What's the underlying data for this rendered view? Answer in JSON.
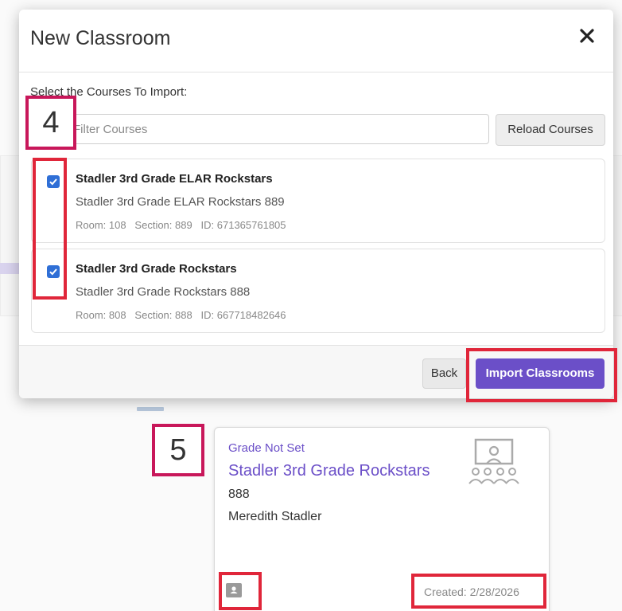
{
  "modal": {
    "title": "New Classroom",
    "close_icon": "close-icon",
    "select_label": "Select the Courses To Import:",
    "filter_placeholder": "Filter Courses",
    "reload_label": "Reload Courses",
    "courses": [
      {
        "checked": true,
        "name": "Stadler 3rd Grade ELAR Rockstars",
        "subtitle": "Stadler 3rd Grade ELAR Rockstars 889",
        "meta": "Room: 108   Section: 889   ID: 671365761805"
      },
      {
        "checked": true,
        "name": "Stadler 3rd Grade Rockstars",
        "subtitle": "Stadler 3rd Grade Rockstars 888",
        "meta": "Room: 808   Section: 888   ID: 667718482646"
      }
    ],
    "back_label": "Back",
    "import_label": "Import Classrooms"
  },
  "annotations": {
    "step_four": "4",
    "step_five": "5",
    "highlight_color": "#e0263a",
    "badge_border_color": "#c8175a"
  },
  "classroom_card": {
    "grade": "Grade Not Set",
    "title": "Stadler 3rd Grade Rockstars",
    "section": "888",
    "teacher": "Meredith Stadler",
    "created": "Created: 2/28/2026",
    "classroom_icon": "classroom-presentation-icon",
    "google_classroom_icon": "google-classroom-icon"
  },
  "colors": {
    "accent": "#6b4fc8",
    "checkbox": "#2f6fd6"
  }
}
